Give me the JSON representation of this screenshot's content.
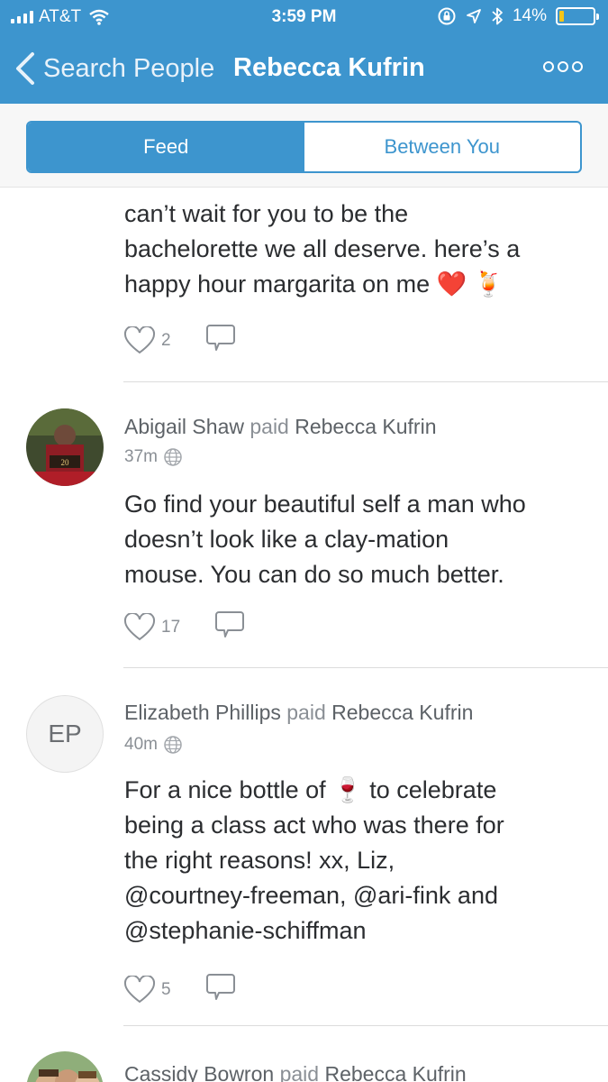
{
  "status_bar": {
    "carrier": "AT&T",
    "time": "3:59 PM",
    "battery": "14%",
    "battery_level": 0.14
  },
  "nav": {
    "back_label": "Search People",
    "title": "Rebecca Kufrin"
  },
  "tabs": {
    "feed": "Feed",
    "between": "Between You"
  },
  "stories": [
    {
      "note_lines": [
        "can’t wait for you to be the",
        "bachelorette we all deserve. here’s a",
        "happy hour margarita on me ❤️ 🍹"
      ],
      "likes": "2"
    },
    {
      "actor": "Abigail Shaw",
      "verb": "paid",
      "target": "Rebecca Kufrin",
      "time": "37m",
      "note_lines": [
        "Go find your beautiful self a man who",
        "doesn’t look like a clay-mation",
        "mouse. You can do so much better."
      ],
      "likes": "17"
    },
    {
      "actor": "Elizabeth Phillips",
      "initials": "EP",
      "verb": "paid",
      "target": "Rebecca Kufrin",
      "time": "40m",
      "note_lines": [
        "For a nice bottle of 🍷 to celebrate",
        "being a class act who was there for",
        "the right reasons!  xx, Liz,",
        "@courtney-freeman, @ari-fink and",
        "@stephanie-schiffman"
      ],
      "likes": "5"
    },
    {
      "actor": "Cassidy Bowron",
      "verb": "paid",
      "target": "Rebecca Kufrin"
    }
  ],
  "colors": {
    "brand": "#3d95ce"
  }
}
